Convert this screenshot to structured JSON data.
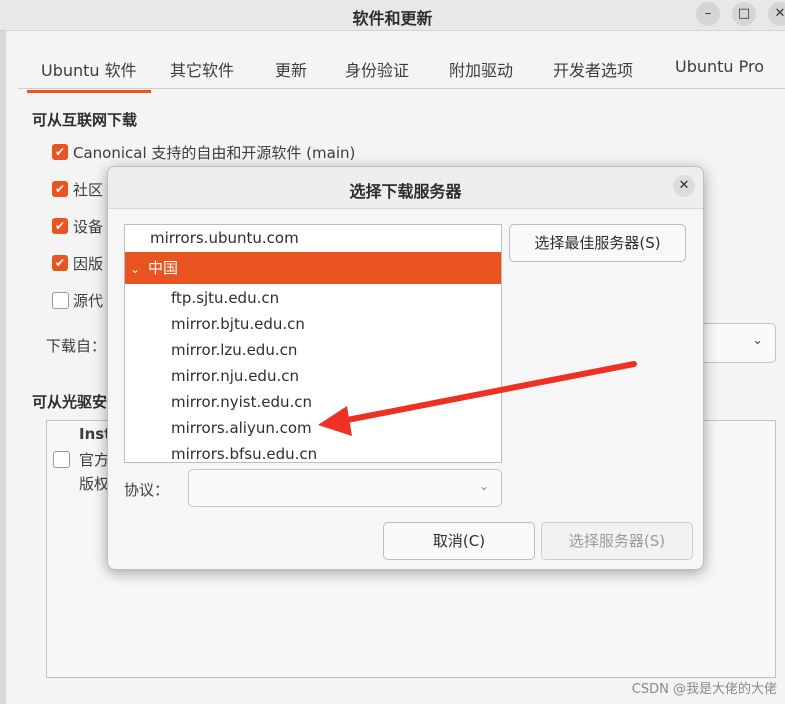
{
  "window": {
    "title": "软件和更新",
    "minimize_glyph": "–",
    "maximize_glyph": "□",
    "close_glyph": "✕"
  },
  "tabs": [
    {
      "label": "Ubuntu 软件",
      "active": true
    },
    {
      "label": "其它软件"
    },
    {
      "label": "更新"
    },
    {
      "label": "身份验证"
    },
    {
      "label": "附加驱动"
    },
    {
      "label": "开发者选项"
    },
    {
      "label": "Ubuntu Pro"
    }
  ],
  "background": {
    "internet_section_title": "可从互联网下载",
    "options": [
      {
        "label": "Canonical 支持的自由和开源软件 (main)",
        "checked": true
      },
      {
        "label": "社区",
        "checked": true
      },
      {
        "label": "设备",
        "checked": true
      },
      {
        "label": "因版",
        "checked": true
      },
      {
        "label": "源代",
        "checked": false
      }
    ],
    "download_from_label": "下载自：",
    "cdrom_section_title": "可从光驱安",
    "cdrom_box_text": [
      "Inst",
      "官方",
      "版权"
    ]
  },
  "dialog": {
    "title": "选择下载服务器",
    "close_glyph": "✕",
    "mirrors": {
      "top": "mirrors.ubuntu.com",
      "group": "中国",
      "children": [
        "ftp.sjtu.edu.cn",
        "mirror.bjtu.edu.cn",
        "mirror.lzu.edu.cn",
        "mirror.nju.edu.cn",
        "mirror.nyist.edu.cn",
        "mirrors.aliyun.com",
        "mirrors.bfsu.edu.cn"
      ]
    },
    "select_best_label": "选择最佳服务器(S)",
    "protocol_label": "协议：",
    "protocol_value": "",
    "cancel_label": "取消(C)",
    "choose_label": "选择服务器(S)"
  },
  "icons": {
    "check": "✔",
    "chevron": "⌄"
  },
  "colors": {
    "accent": "#e95420",
    "annotation_arrow": "#ee3124"
  },
  "watermark": "CSDN @我是大佬的大佬"
}
